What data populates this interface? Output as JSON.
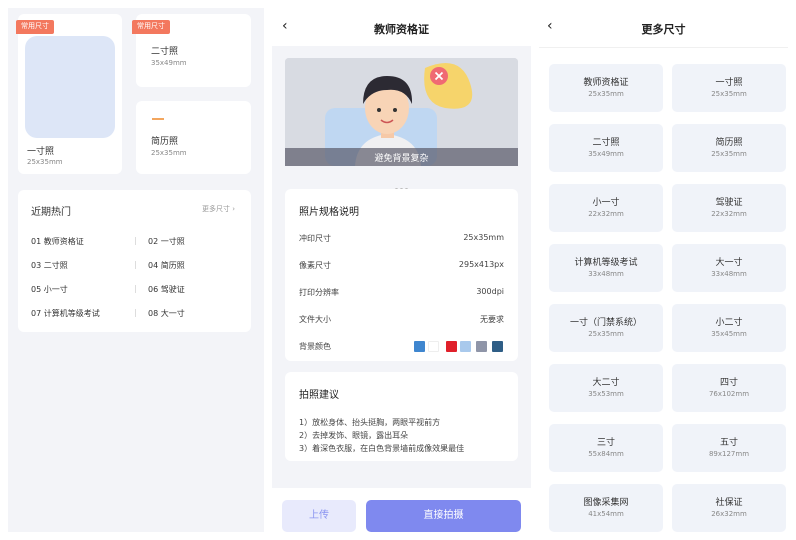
{
  "panel1": {
    "featured": [
      {
        "badge": "常用尺寸",
        "title": "一寸照",
        "size": "25x35mm"
      },
      {
        "badge": "常用尺寸",
        "title": "二寸照",
        "size": "35x49mm"
      },
      {
        "title": "简历照",
        "size": "25x35mm"
      }
    ],
    "hot": {
      "heading": "近期热门",
      "more": "更多尺寸 ›",
      "items": [
        "01 教师资格证",
        "02 一寸照",
        "03 二寸照",
        "04 简历照",
        "05 小一寸",
        "06 驾驶证",
        "07 计算机等级考试",
        "08 大一寸"
      ]
    }
  },
  "panel2": {
    "back": "‹",
    "title": "教师资格证",
    "banner_caption": "避免背景复杂",
    "spec": {
      "heading": "照片规格说明",
      "rows": [
        {
          "label": "冲印尺寸",
          "value": "25x35mm"
        },
        {
          "label": "像素尺寸",
          "value": "295x413px"
        },
        {
          "label": "打印分辨率",
          "value": "300dpi"
        },
        {
          "label": "文件大小",
          "value": "无要求"
        }
      ],
      "bg_label": "背景颜色",
      "colors": [
        "#3f86cf",
        "#ffffff",
        "#e0202a",
        "#a9c9ec",
        "#8f95a8",
        "#2f5e86"
      ]
    },
    "advice": {
      "heading": "拍照建议",
      "tips": [
        "1）放松身体、抬头挺胸，两眼平视前方",
        "2）去掉发饰、眼镜，露出耳朵",
        "3）着深色衣服，在白色背景墙前成像效果最佳"
      ]
    },
    "upload": "上传",
    "shoot": "直接拍摄"
  },
  "panel3": {
    "back": "‹",
    "title": "更多尺寸",
    "tiles": [
      {
        "name": "教师资格证",
        "size": "25x35mm"
      },
      {
        "name": "一寸照",
        "size": "25x35mm"
      },
      {
        "name": "二寸照",
        "size": "35x49mm"
      },
      {
        "name": "简历照",
        "size": "25x35mm"
      },
      {
        "name": "小一寸",
        "size": "22x32mm"
      },
      {
        "name": "驾驶证",
        "size": "22x32mm"
      },
      {
        "name": "计算机等级考试",
        "size": "33x48mm"
      },
      {
        "name": "大一寸",
        "size": "33x48mm"
      },
      {
        "name": "一寸（门禁系统）",
        "size": "25x35mm"
      },
      {
        "name": "小二寸",
        "size": "35x45mm"
      },
      {
        "name": "大二寸",
        "size": "35x53mm"
      },
      {
        "name": "四寸",
        "size": "76x102mm"
      },
      {
        "name": "三寸",
        "size": "55x84mm"
      },
      {
        "name": "五寸",
        "size": "89x127mm"
      },
      {
        "name": "图像采集网",
        "size": "41x54mm"
      },
      {
        "name": "社保证",
        "size": "26x32mm"
      }
    ]
  }
}
